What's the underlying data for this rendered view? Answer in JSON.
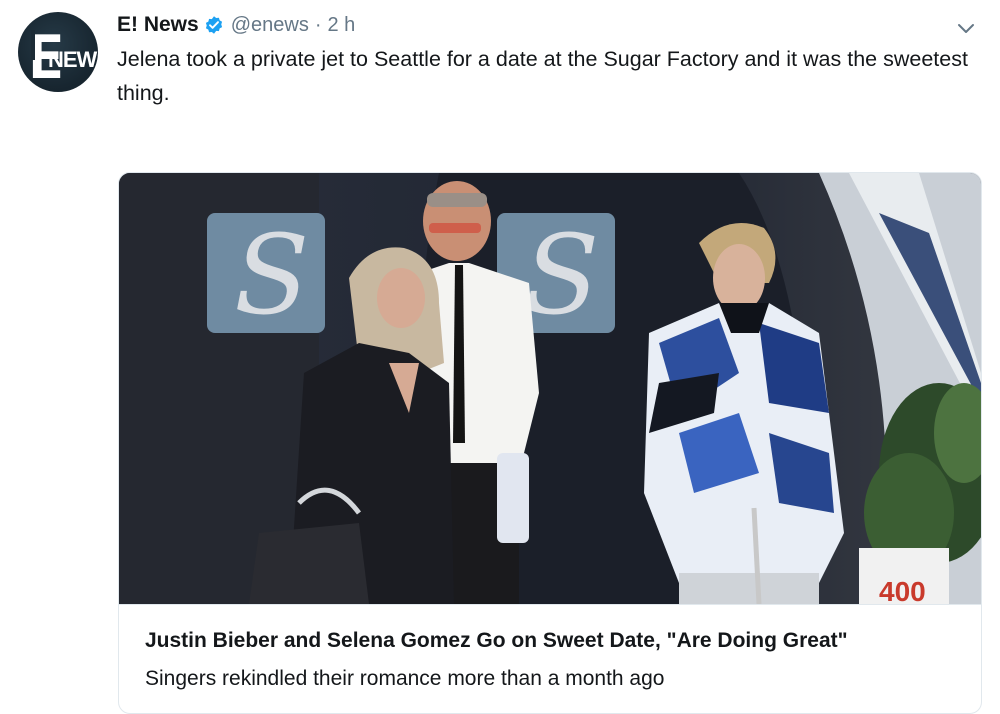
{
  "tweet": {
    "author": {
      "display_name": "E! News",
      "handle": "@enews",
      "avatar_text": "NEWS",
      "avatar_letter": "E"
    },
    "separator": "·",
    "timestamp": "2 h",
    "text": "Jelena took a private jet to Seattle for a date at the Sugar Factory and it was the sweetest thing.",
    "icons": {
      "verified": "verified-badge-icon",
      "caret": "chevron-down-icon"
    },
    "colors": {
      "verified_blue": "#1da1f2",
      "muted_text": "#657786",
      "avatar_bg": "#1c2b36"
    }
  },
  "card": {
    "image_letters": [
      "S",
      "S"
    ],
    "sign_text": "400",
    "title": "Justin Bieber and Selena Gomez Go on Sweet Date, \"Are Doing Great\"",
    "description": "Singers rekindled their romance more than a month ago"
  }
}
